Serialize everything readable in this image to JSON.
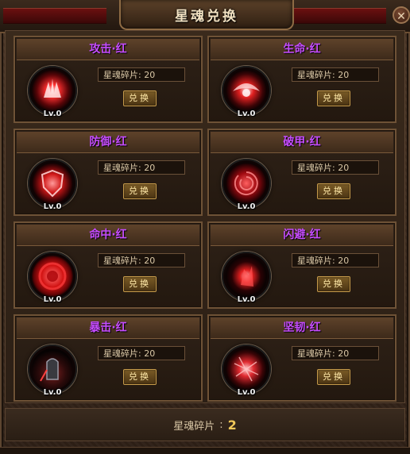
{
  "window": {
    "title": "星魂兑换",
    "close_label": "✕"
  },
  "cards": [
    {
      "title": "攻击·红",
      "level": "Lv.0",
      "fragments": "星魂碎片: 20",
      "button": "兑换",
      "icon": "attack-soul-icon"
    },
    {
      "title": "生命·红",
      "level": "Lv.0",
      "fragments": "星魂碎片: 20",
      "button": "兑换",
      "icon": "life-soul-icon"
    },
    {
      "title": "防御·红",
      "level": "Lv.0",
      "fragments": "星魂碎片: 20",
      "button": "兑换",
      "icon": "defense-soul-icon"
    },
    {
      "title": "破甲·红",
      "level": "Lv.0",
      "fragments": "星魂碎片: 20",
      "button": "兑换",
      "icon": "armor-break-soul-icon"
    },
    {
      "title": "命中·红",
      "level": "Lv.0",
      "fragments": "星魂碎片: 20",
      "button": "兑换",
      "icon": "hit-soul-icon"
    },
    {
      "title": "闪避·红",
      "level": "Lv.0",
      "fragments": "星魂碎片: 20",
      "button": "兑换",
      "icon": "dodge-soul-icon"
    },
    {
      "title": "暴击·红",
      "level": "Lv.0",
      "fragments": "星魂碎片: 20",
      "button": "兑换",
      "icon": "crit-soul-icon"
    },
    {
      "title": "坚韧·红",
      "level": "Lv.0",
      "fragments": "星魂碎片: 20",
      "button": "兑换",
      "icon": "toughness-soul-icon"
    }
  ],
  "footer": {
    "label": "星魂碎片",
    "separator": ":",
    "count": "2"
  },
  "colors": {
    "card_title": "#c54cff",
    "orb_red": "#e0202a",
    "count": "#f0c85a"
  }
}
